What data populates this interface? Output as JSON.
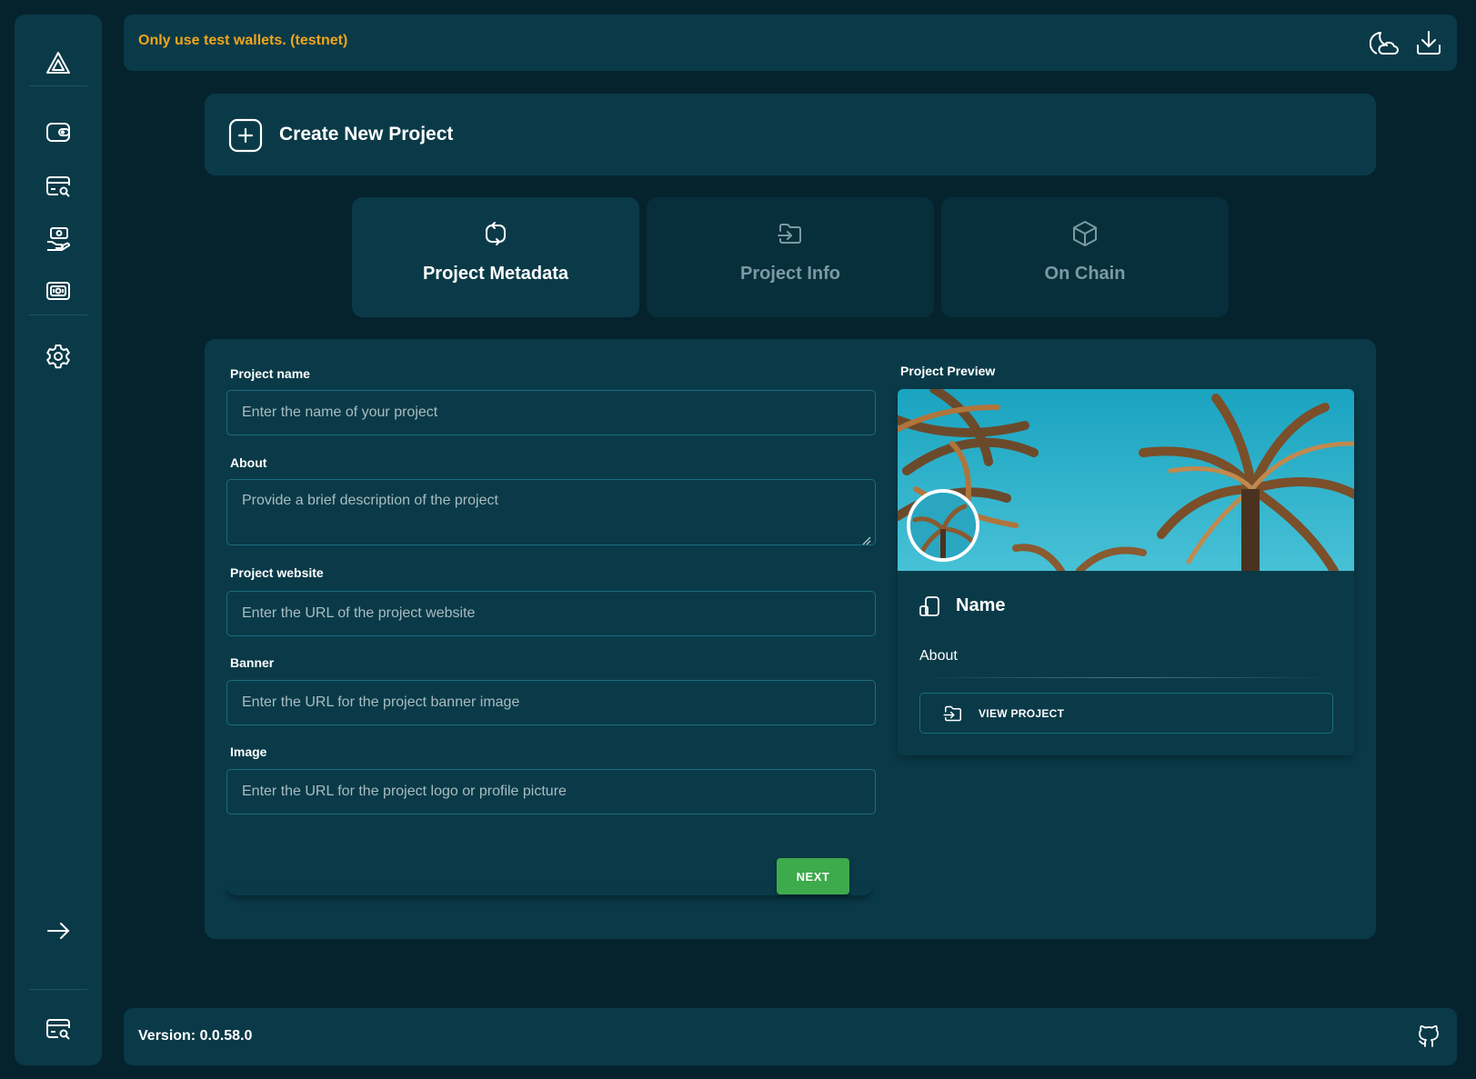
{
  "app": {
    "warning": "Only use test wallets. (testnet)",
    "version_text": "Version: 0.0.58.0"
  },
  "sidebar": {
    "items": [
      {
        "icon": "logo-icon"
      },
      {
        "icon": "wallet-icon"
      },
      {
        "icon": "card-search-icon"
      },
      {
        "icon": "hand-money-icon"
      },
      {
        "icon": "cash-icon"
      },
      {
        "icon": "gear-icon"
      },
      {
        "icon": "arrow-right-icon"
      },
      {
        "icon": "card-search-icon"
      }
    ]
  },
  "topbar": {
    "icons": [
      "theme-toggle-icon",
      "download-icon"
    ]
  },
  "header": {
    "title": "Create New Project"
  },
  "tabs": [
    {
      "label": "Project Metadata",
      "icon": "refresh-icon",
      "active": true
    },
    {
      "label": "Project Info",
      "icon": "folder-import-icon",
      "active": false
    },
    {
      "label": "On Chain",
      "icon": "cube-icon",
      "active": false
    }
  ],
  "form": {
    "fields": [
      {
        "label": "Project name",
        "placeholder": "Enter the name of your project",
        "value": ""
      },
      {
        "label": "About",
        "placeholder": "Provide a brief description of the project",
        "value": ""
      },
      {
        "label": "Project website",
        "placeholder": "Enter the URL of the project website",
        "value": ""
      },
      {
        "label": "Banner",
        "placeholder": "Enter the URL for the project banner image",
        "value": ""
      },
      {
        "label": "Image",
        "placeholder": "Enter the URL for the project logo or profile picture",
        "value": ""
      }
    ],
    "next_label": "NEXT"
  },
  "preview": {
    "label": "Project Preview",
    "name": "Name",
    "about": "About",
    "button_label": "VIEW PROJECT"
  },
  "colors": {
    "background": "#05232d",
    "panel": "#0a3a48",
    "warning": "#f0a51c",
    "accent_green": "#3daa4c",
    "input_border": "#1c6c7d"
  }
}
